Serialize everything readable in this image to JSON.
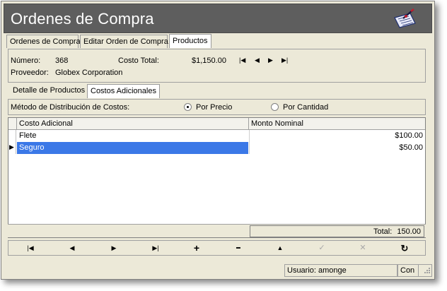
{
  "window": {
    "title": "Ordenes de Compra"
  },
  "tabs": [
    {
      "label": "Ordenes de Compra"
    },
    {
      "label": "Editar Orden de Compra"
    },
    {
      "label": "Productos"
    }
  ],
  "info": {
    "numero_label": "Número:",
    "numero_value": "368",
    "costo_total_label": "Costo Total:",
    "costo_total_value": "$1,150.00",
    "proveedor_label": "Proveedor:",
    "proveedor_value": "Globex Corporation",
    "nav": [
      "|◀",
      "◀",
      "▶",
      "▶|"
    ]
  },
  "subtabs": [
    {
      "label": "Detalle de Productos"
    },
    {
      "label": "Costos Adicionales"
    }
  ],
  "distribution": {
    "label": "Método de Distribución de Costos:",
    "options": [
      {
        "label": "Por Precio",
        "selected": true
      },
      {
        "label": "Por Cantidad",
        "selected": false
      }
    ]
  },
  "grid": {
    "columns": [
      "Costo Adicional",
      "Monto Nominal"
    ],
    "rows": [
      {
        "name": "Flete",
        "amount": "$100.00",
        "selected": false
      },
      {
        "name": "Seguro",
        "amount": "$50.00",
        "selected": true
      }
    ],
    "current_row_marker": "▶",
    "total_label": "Total:",
    "total_value": "150.00"
  },
  "toolbar": {
    "buttons": [
      {
        "icon": "first-record-icon",
        "glyph": "|◀",
        "enabled": true
      },
      {
        "icon": "prev-record-icon",
        "glyph": "◀",
        "enabled": true
      },
      {
        "icon": "next-record-icon",
        "glyph": "▶",
        "enabled": true
      },
      {
        "icon": "last-record-icon",
        "glyph": "▶|",
        "enabled": true
      },
      {
        "icon": "add-icon",
        "glyph": "+",
        "enabled": true
      },
      {
        "icon": "delete-icon",
        "glyph": "━",
        "enabled": true
      },
      {
        "icon": "edit-icon",
        "glyph": "▲",
        "enabled": true
      },
      {
        "icon": "post-icon",
        "glyph": "✓",
        "enabled": false
      },
      {
        "icon": "cancel-icon",
        "glyph": "✕",
        "enabled": false
      },
      {
        "icon": "refresh-icon",
        "glyph": "↻",
        "enabled": true
      }
    ]
  },
  "status": {
    "user": "Usuario: amonge",
    "connection": "Con"
  },
  "colors": {
    "titlebar": "#5e5e5e",
    "selection": "#3b78e7",
    "face": "#ece9d8"
  }
}
